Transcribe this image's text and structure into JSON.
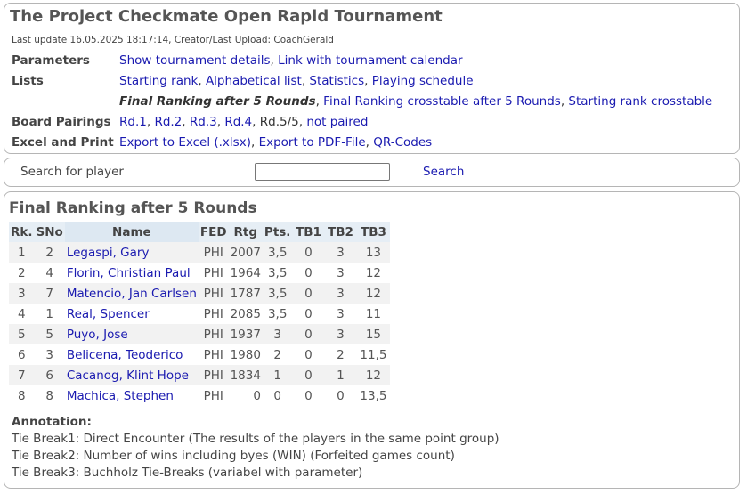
{
  "header": {
    "title": "The Project Checkmate Open Rapid Tournament",
    "last_update": "Last update 16.05.2025 18:17:14, Creator/Last Upload: CoachGerald",
    "parameters_label": "Parameters",
    "show_details": "Show tournament details",
    "calendar_link": "Link with tournament calendar",
    "lists_label": "Lists",
    "starting_rank": "Starting rank",
    "alphabetical": "Alphabetical list",
    "statistics": "Statistics",
    "schedule": "Playing schedule",
    "final_ranking_current": "Final Ranking after 5 Rounds",
    "final_crosstable": "Final Ranking crosstable after 5 Rounds",
    "starting_crosstable": "Starting rank crosstable",
    "board_pairings_label": "Board Pairings",
    "rd1": "Rd.1",
    "rd2": "Rd.2",
    "rd3": "Rd.3",
    "rd4": "Rd.4",
    "rd5": "Rd.5/5",
    "not_paired": "not paired",
    "excel_label": "Excel and Print",
    "export_excel": "Export to Excel (.xlsx)",
    "export_pdf": "Export to PDF-File",
    "qr_codes": "QR-Codes"
  },
  "search": {
    "label": "Search for player",
    "input_value": "",
    "button": "Search"
  },
  "ranking": {
    "title": "Final Ranking after 5 Rounds",
    "columns": [
      "Rk.",
      "SNo",
      "Name",
      "FED",
      "Rtg",
      "Pts.",
      "TB1",
      "TB2",
      "TB3"
    ],
    "rows": [
      [
        "1",
        "2",
        "Legaspi, Gary",
        "PHI",
        "2007",
        "3,5",
        "0",
        "3",
        "13"
      ],
      [
        "2",
        "4",
        "Florin, Christian Paul",
        "PHI",
        "1964",
        "3,5",
        "0",
        "3",
        "12"
      ],
      [
        "3",
        "7",
        "Matencio, Jan Carlsen",
        "PHI",
        "1787",
        "3,5",
        "0",
        "3",
        "12"
      ],
      [
        "4",
        "1",
        "Real, Spencer",
        "PHI",
        "2085",
        "3,5",
        "0",
        "3",
        "11"
      ],
      [
        "5",
        "5",
        "Puyo, Jose",
        "PHI",
        "1937",
        "3",
        "0",
        "3",
        "15"
      ],
      [
        "6",
        "3",
        "Belicena, Teoderico",
        "PHI",
        "1980",
        "2",
        "0",
        "2",
        "11,5"
      ],
      [
        "7",
        "6",
        "Cacanog, Klint Hope",
        "PHI",
        "1834",
        "1",
        "0",
        "1",
        "12"
      ],
      [
        "8",
        "8",
        "Machica, Stephen",
        "PHI",
        "0",
        "0",
        "0",
        "0",
        "13,5"
      ]
    ]
  },
  "annotation": {
    "title": "Annotation:",
    "tb1": "Tie Break1: Direct Encounter (The results of the players in the same point group)",
    "tb2": "Tie Break2: Number of wins including byes (WIN) (Forfeited games count)",
    "tb3": "Tie Break3: Buchholz Tie-Breaks (variabel with parameter)"
  }
}
